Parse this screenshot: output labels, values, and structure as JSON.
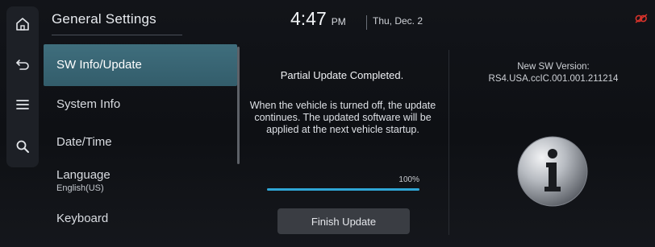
{
  "header": {
    "title": "General Settings",
    "time": "4:47",
    "ampm": "PM",
    "date": "Thu, Dec. 2"
  },
  "rail": {
    "icons": [
      "home-icon",
      "back-icon",
      "menu-icon",
      "search-icon"
    ]
  },
  "menu": {
    "items": [
      {
        "label": "SW Info/Update",
        "active": true
      },
      {
        "label": "System Info",
        "active": false
      },
      {
        "label": "Date/Time",
        "active": false
      },
      {
        "label": "Language",
        "sub": "English(US)",
        "active": false
      },
      {
        "label": "Keyboard",
        "active": false
      }
    ]
  },
  "update": {
    "title": "Partial Update Completed.",
    "description": "When the vehicle is turned off, the update continues. The updated software will be applied at the next vehicle startup.",
    "progress_label": "100%",
    "progress": 1.0,
    "finish_button": "Finish Update"
  },
  "version": {
    "label": "New SW Version:",
    "value": "RS4.USA.ccIC.001.001.211214"
  },
  "colors": {
    "accent": "#2fa6d6",
    "active_item": "#3f6e7d",
    "status_red": "#d8332b"
  }
}
